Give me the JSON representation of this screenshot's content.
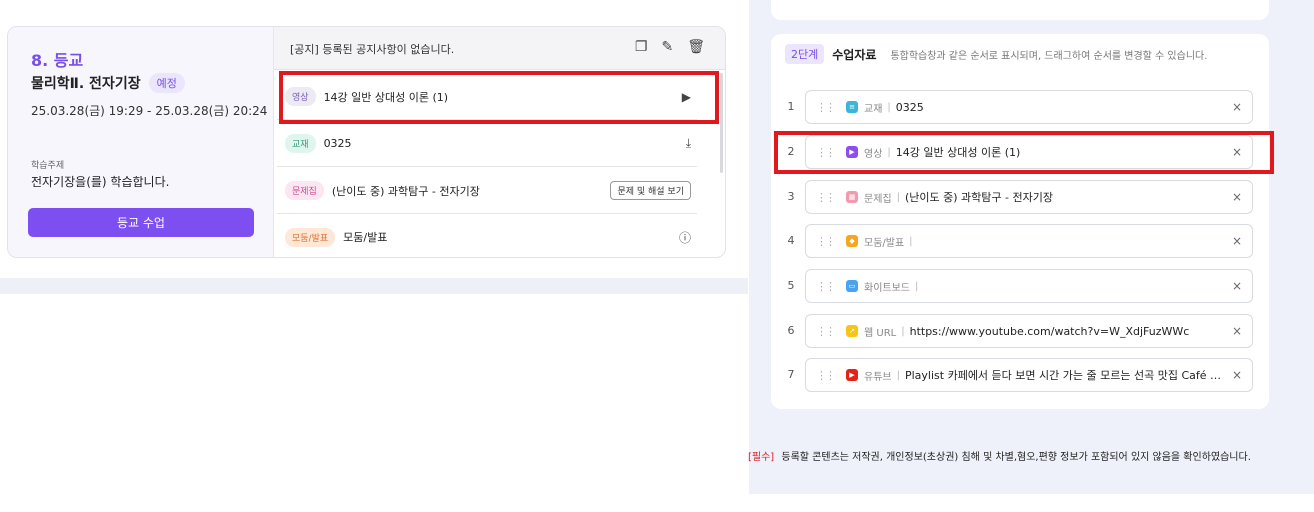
{
  "lesson": {
    "number_title": "8. 등교",
    "title": "물리학Ⅱ. 전자기장",
    "badge": "예정",
    "date_range": "25.03.28(금) 19:29 - 25.03.28(금) 20:24",
    "topic_label": "학습주제",
    "topic": "전자기장을(를) 학습합니다.",
    "enter_button": "등교 수업"
  },
  "notice": {
    "text": "[공지] 등록된 공지사항이 없습니다.",
    "icons": [
      "copy-icon",
      "edit-icon",
      "trash-icon"
    ]
  },
  "materials": [
    {
      "tag": "영상",
      "name": "14강 일반 상대성 이론 (1)",
      "icon": "play-icon"
    },
    {
      "tag": "교재",
      "name": "0325",
      "icon": "download-icon"
    },
    {
      "tag": "문제집",
      "name": "(난이도 중) 과학탐구 - 전자기장",
      "button": "문제 및 해설 보기"
    },
    {
      "tag": "모둠/발표",
      "name": "모둠/발표",
      "icon": "info-icon"
    }
  ],
  "step": {
    "badge": "2단계",
    "title": "수업자료",
    "description": "통합학습창과 같은 순서로 표시되며, 드래그하여 순서를 변경할 수 있습니다."
  },
  "resources": [
    {
      "num": "1",
      "type": "교재",
      "title": "0325",
      "color": "#3cb6d6",
      "icon": "textbook-icon"
    },
    {
      "num": "2",
      "type": "영상",
      "title": "14강 일반 상대성 이론 (1)",
      "color": "#8b4ff0",
      "icon": "video-icon"
    },
    {
      "num": "3",
      "type": "문제집",
      "title": "(난이도 중) 과학탐구 - 전자기장",
      "color": "#f39ab0",
      "icon": "quiz-icon"
    },
    {
      "num": "4",
      "type": "모둠/발표",
      "title": "",
      "color": "#f5a623",
      "icon": "group-icon"
    },
    {
      "num": "5",
      "type": "화이트보드",
      "title": "",
      "color": "#4aa3f0",
      "icon": "whiteboard-icon"
    },
    {
      "num": "6",
      "type": "웹 URL",
      "title": "https://www.youtube.com/watch?v=W_XdjFuzWWc",
      "color": "#f5c518",
      "icon": "link-icon"
    },
    {
      "num": "7",
      "type": "유튜브",
      "title": "Playlist 카페에서 듣다 보면 시간 가는 줄 모르는 선곡 맛집 Café Vibe…",
      "color": "#e62117",
      "icon": "youtube-icon"
    }
  ],
  "required": {
    "tag": "[필수]",
    "text": "등록할 콘텐츠는 저작권, 개인정보(초상권) 침해 및 차별,혐오,편향 정보가 포함되어 있지 않음을 확인하였습니다."
  }
}
